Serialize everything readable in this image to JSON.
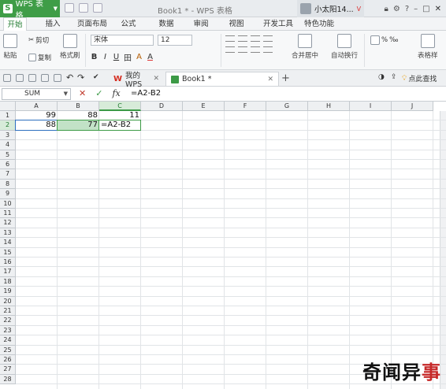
{
  "titlebar": {
    "app_name": "WPS 表格",
    "app_logo": "S",
    "doc_title": "Book1 * - WPS 表格",
    "user_name": "小太阳14...",
    "vip_badge": "V",
    "window_buttons": [
      "lock-icon",
      "gear-icon",
      "help-icon",
      "minimize-icon",
      "maximize-icon",
      "close-icon"
    ]
  },
  "ribbon": {
    "tabs": [
      "开始",
      "插入",
      "页面布局",
      "公式",
      "数据",
      "审阅",
      "视图",
      "开发工具",
      "特色功能"
    ],
    "active_tab": "开始",
    "paste_label": "粘贴",
    "cut_label": "剪切",
    "copy_label": "复制",
    "format_painter_label": "格式刷",
    "font_name": "宋体",
    "font_size": "12",
    "format_buttons": [
      "B",
      "I",
      "U",
      "田",
      "A",
      "A"
    ],
    "merge_label": "合并居中",
    "wrap_label": "自动换行",
    "number_buttons": [
      "%",
      "‰"
    ],
    "table_style_label": "表格样"
  },
  "doc_tabs": {
    "home_tab": "我的WPS",
    "book_tab": "Book1 *",
    "add_tab": "+",
    "tip_label": "点此查找"
  },
  "formula_bar": {
    "name_box": "SUM",
    "cancel": "✕",
    "confirm": "✓",
    "fx": "fx",
    "formula": "=A2-B2"
  },
  "grid": {
    "columns": [
      "A",
      "B",
      "C",
      "D",
      "E",
      "F",
      "G",
      "H",
      "I",
      "J"
    ],
    "rows": [
      "1",
      "2",
      "3",
      "4",
      "5",
      "6",
      "7",
      "8",
      "9",
      "10",
      "11",
      "12",
      "13",
      "14",
      "15",
      "16",
      "17",
      "18",
      "19",
      "20",
      "21",
      "22",
      "23",
      "24",
      "25",
      "26",
      "27",
      "28"
    ],
    "active_cell": "C2",
    "cells": {
      "A1": "99",
      "B1": "88",
      "C1": "11",
      "A2": "88",
      "B2": "77",
      "C2": "=A2-B2"
    }
  },
  "watermark": {
    "text_black": "奇闻异",
    "text_red": "事"
  }
}
